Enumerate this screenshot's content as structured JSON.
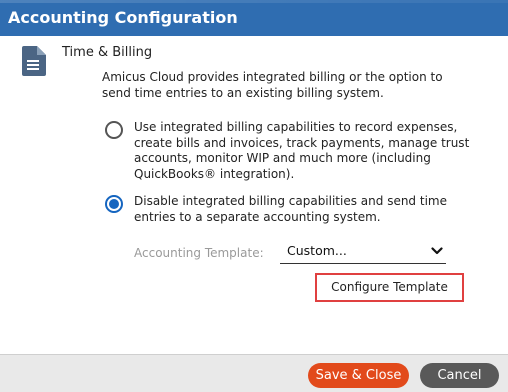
{
  "dialog": {
    "title": "Accounting Configuration"
  },
  "section": {
    "icon": "document-icon",
    "title": "Time & Billing",
    "intro": "Amicus Cloud provides integrated billing or the option to send time entries to an existing billing system."
  },
  "options": [
    {
      "label": "Use integrated billing capabilities to record expenses, create bills and invoices, track payments, manage trust accounts, monitor WIP and much more (including QuickBooks® integration).",
      "selected": false
    },
    {
      "label": "Disable integrated billing capabilities and send time entries to a separate accounting system.",
      "selected": true
    }
  ],
  "template": {
    "label": "Accounting Template:",
    "selected_value": "Custom..."
  },
  "buttons": {
    "configure_template": "Configure Template",
    "save_close": "Save & Close",
    "cancel": "Cancel"
  },
  "colors": {
    "title_bar": "#2f6db1",
    "radio_selected": "#1565c0",
    "save_button": "#e24a1b",
    "cancel_button": "#595959",
    "highlight_border": "#e04040"
  }
}
